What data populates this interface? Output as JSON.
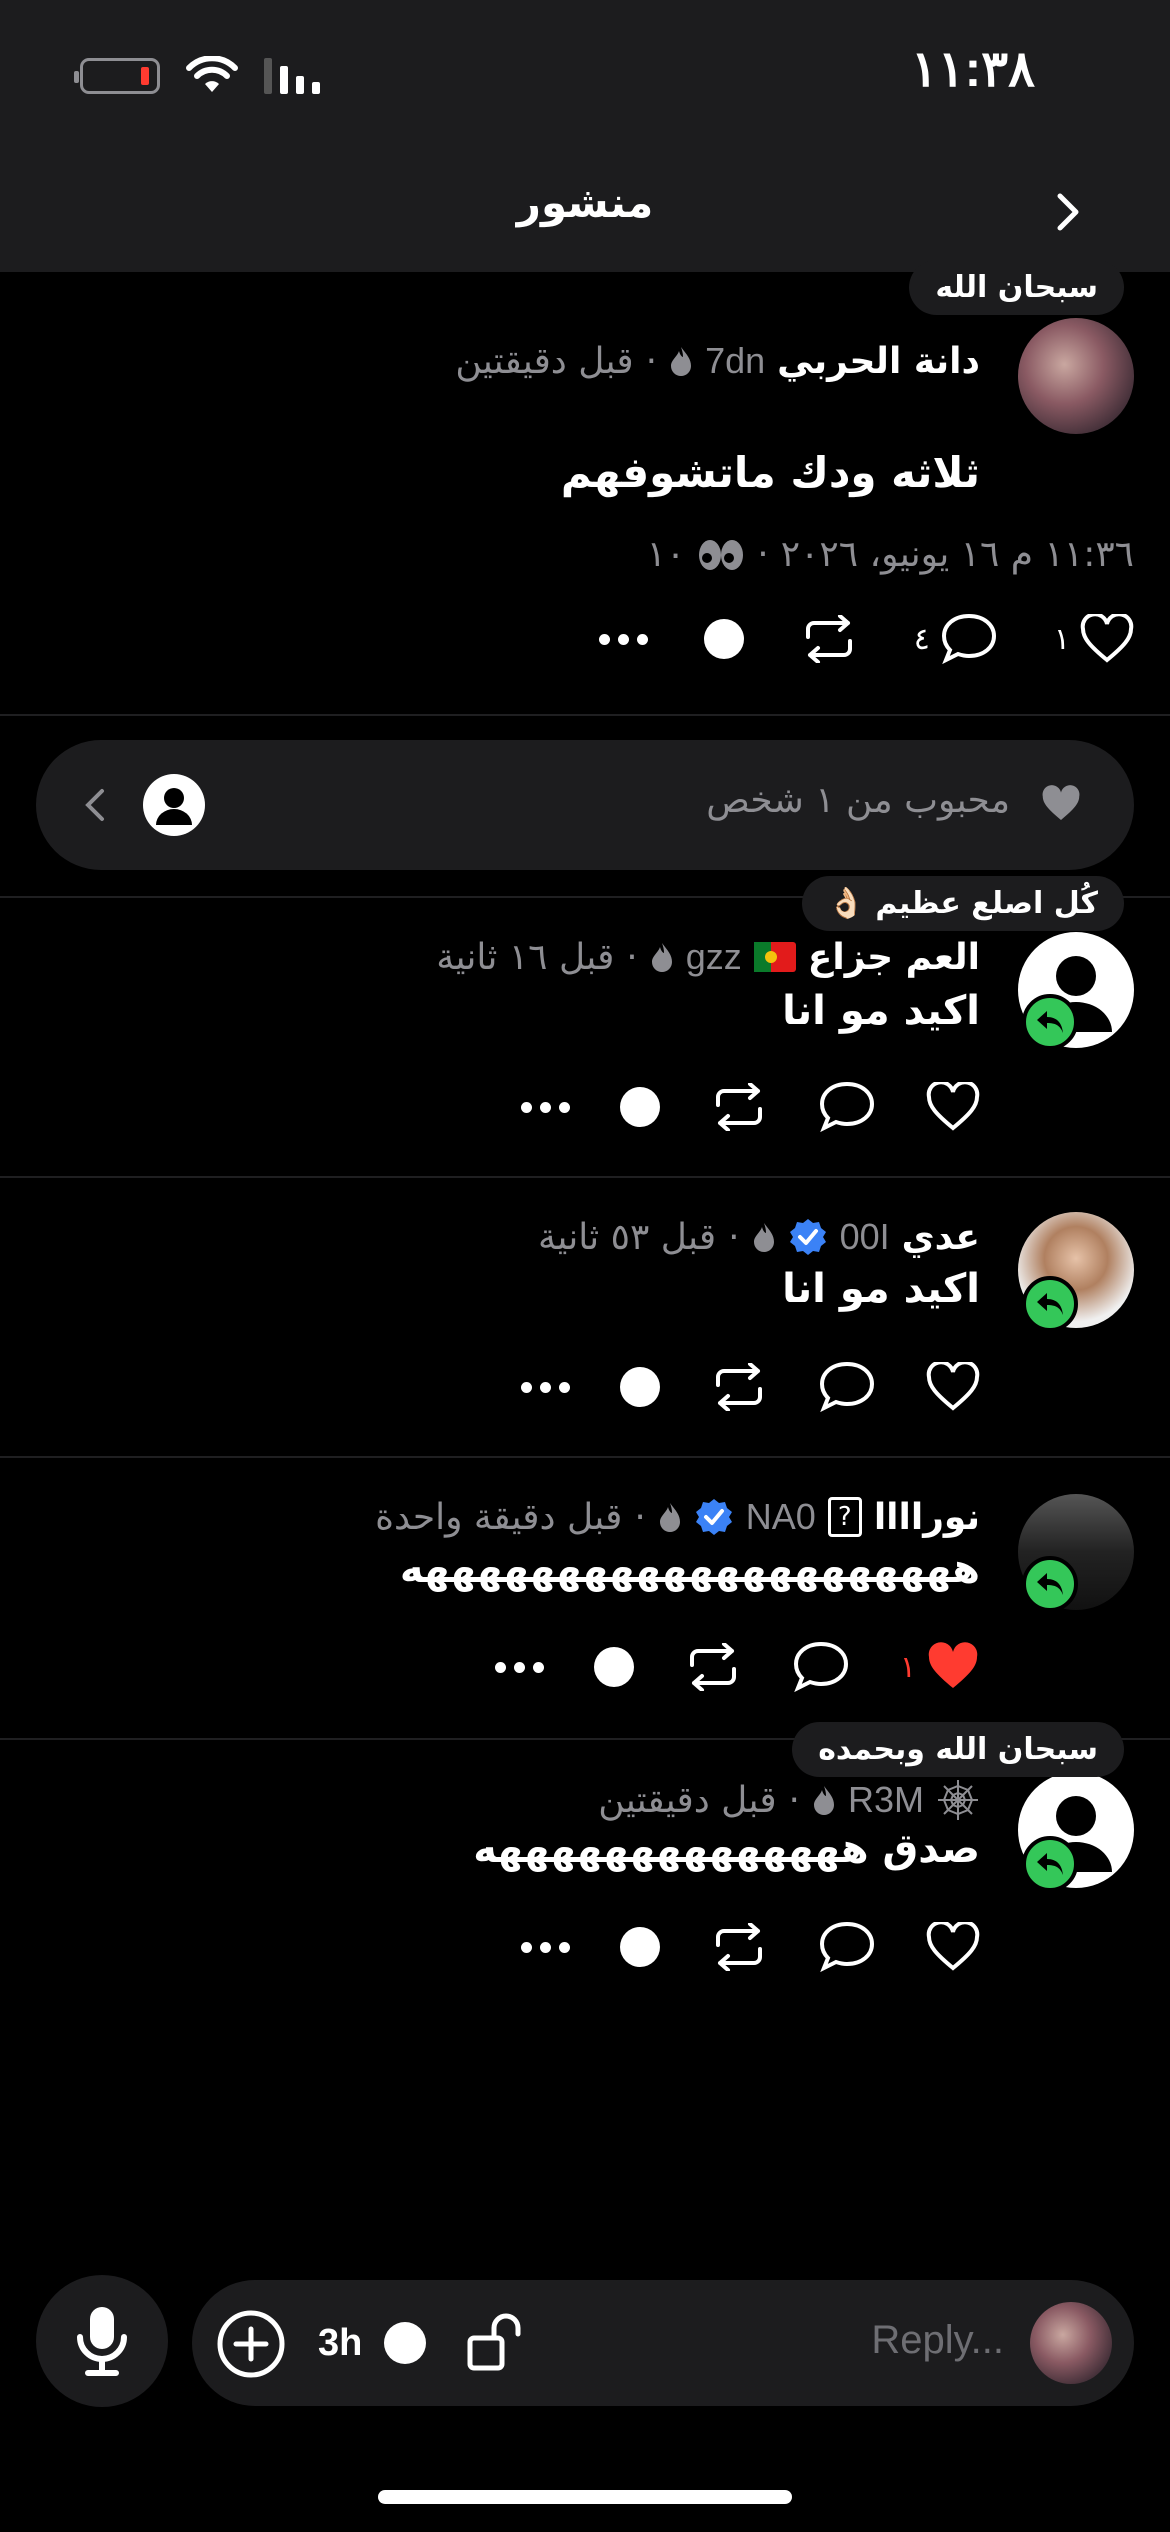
{
  "status_bar": {
    "time": "١١:٣٨"
  },
  "nav": {
    "title": "منشور"
  },
  "main_post": {
    "badge": "سبحان الله",
    "name": "دانة الحربي",
    "handle": "7dn",
    "time_ago": "قبل دقيقتين",
    "text": "ثلاثه ودك ماتشوفهم",
    "date_line": "١١:٣٦ م ١٦ يونيو، ٢٠٢٦",
    "views": "١٠",
    "likes": "١",
    "comments": "٤"
  },
  "likes_row": {
    "label": "محبوب من ١ شخص"
  },
  "comments": [
    {
      "badge": "كُل اصلع عظيم 👌🏻",
      "name": "العم جزاع",
      "handle": "gzz",
      "time_ago": "قبل ١٦ ثانية",
      "text": "اكيد مو انا",
      "likes": "",
      "liked": false
    },
    {
      "badge": "",
      "name": "عدي",
      "handle": "00I",
      "time_ago": "قبل ٥٣ ثانية",
      "text": "اكيد مو انا",
      "likes": "",
      "liked": false
    },
    {
      "badge": "",
      "name": "نوراااا",
      "handle": "NA0",
      "time_ago": "قبل دقيقة واحدة",
      "text": "هههههههههههههههههههههه",
      "likes": "١",
      "liked": true
    },
    {
      "badge": "سبحان الله وبحمده",
      "name": "",
      "handle": "R3M",
      "time_ago": "قبل دقيقتين",
      "text": "صدق ههههههههههههههه",
      "likes": "",
      "liked": false
    }
  ],
  "composer": {
    "timer": "3h",
    "placeholder": "Reply..."
  },
  "colors": {
    "accent_green": "#34c759",
    "like_red": "#ff3b30",
    "verified_blue": "#3b82f6"
  }
}
